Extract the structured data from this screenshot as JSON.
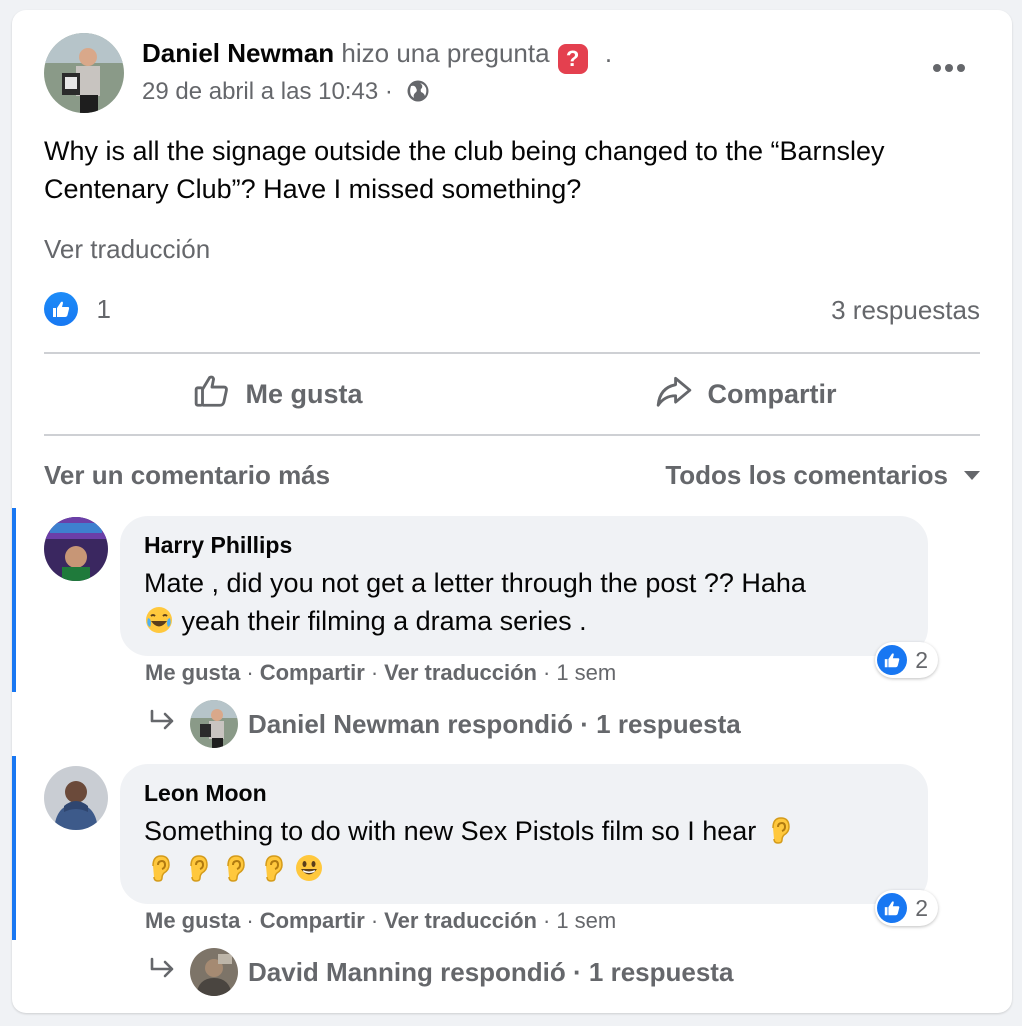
{
  "post": {
    "author": "Daniel Newman",
    "action": "hizo una pregunta",
    "question_badge": "?",
    "dot": ".",
    "timestamp": "29 de abril a las 10:43 ·",
    "body": "Why is all the signage outside the club being changed to the “Barnsley Centenary Club”? Have I missed something?",
    "translate_label": "Ver traducción",
    "reaction_count": "1",
    "replies_count": "3 respuestas",
    "like_button": "Me gusta",
    "share_button": "Compartir"
  },
  "comments_header": {
    "more_comments": "Ver un comentario más",
    "sort_label": "Todos los comentarios"
  },
  "comments": [
    {
      "name": "Harry Phillips",
      "text_line1": "Mate , did you not get a letter through the post ?? Haha",
      "text_line2": " yeah their filming a drama series .",
      "reactions": "2",
      "like": "Me gusta",
      "share": "Compartir",
      "translate": "Ver traducción",
      "time": "1 sem",
      "reply_summary": "Daniel Newman respondió · 1 respuesta"
    },
    {
      "name": "Leon Moon",
      "text_line1": "Something to do with new Sex Pistols film so I hear",
      "reactions": "2",
      "like": "Me gusta",
      "share": "Compartir",
      "translate": "Ver traducción",
      "time": "1 sem",
      "reply_summary": "David Manning respondió · 1 respuesta"
    }
  ],
  "icons": {
    "more": "more-horizontal-icon",
    "globe": "globe-icon",
    "like": "thumbs-up-icon",
    "share": "share-arrow-icon",
    "reply": "reply-arrow-icon",
    "laugh": "laughing-emoji-icon",
    "ear": "ear-emoji-icon",
    "grin": "grinning-emoji-icon"
  },
  "colors": {
    "accent": "#1877f2",
    "muted": "#65676b",
    "bubble": "#f0f2f5",
    "question": "#e4404f"
  }
}
